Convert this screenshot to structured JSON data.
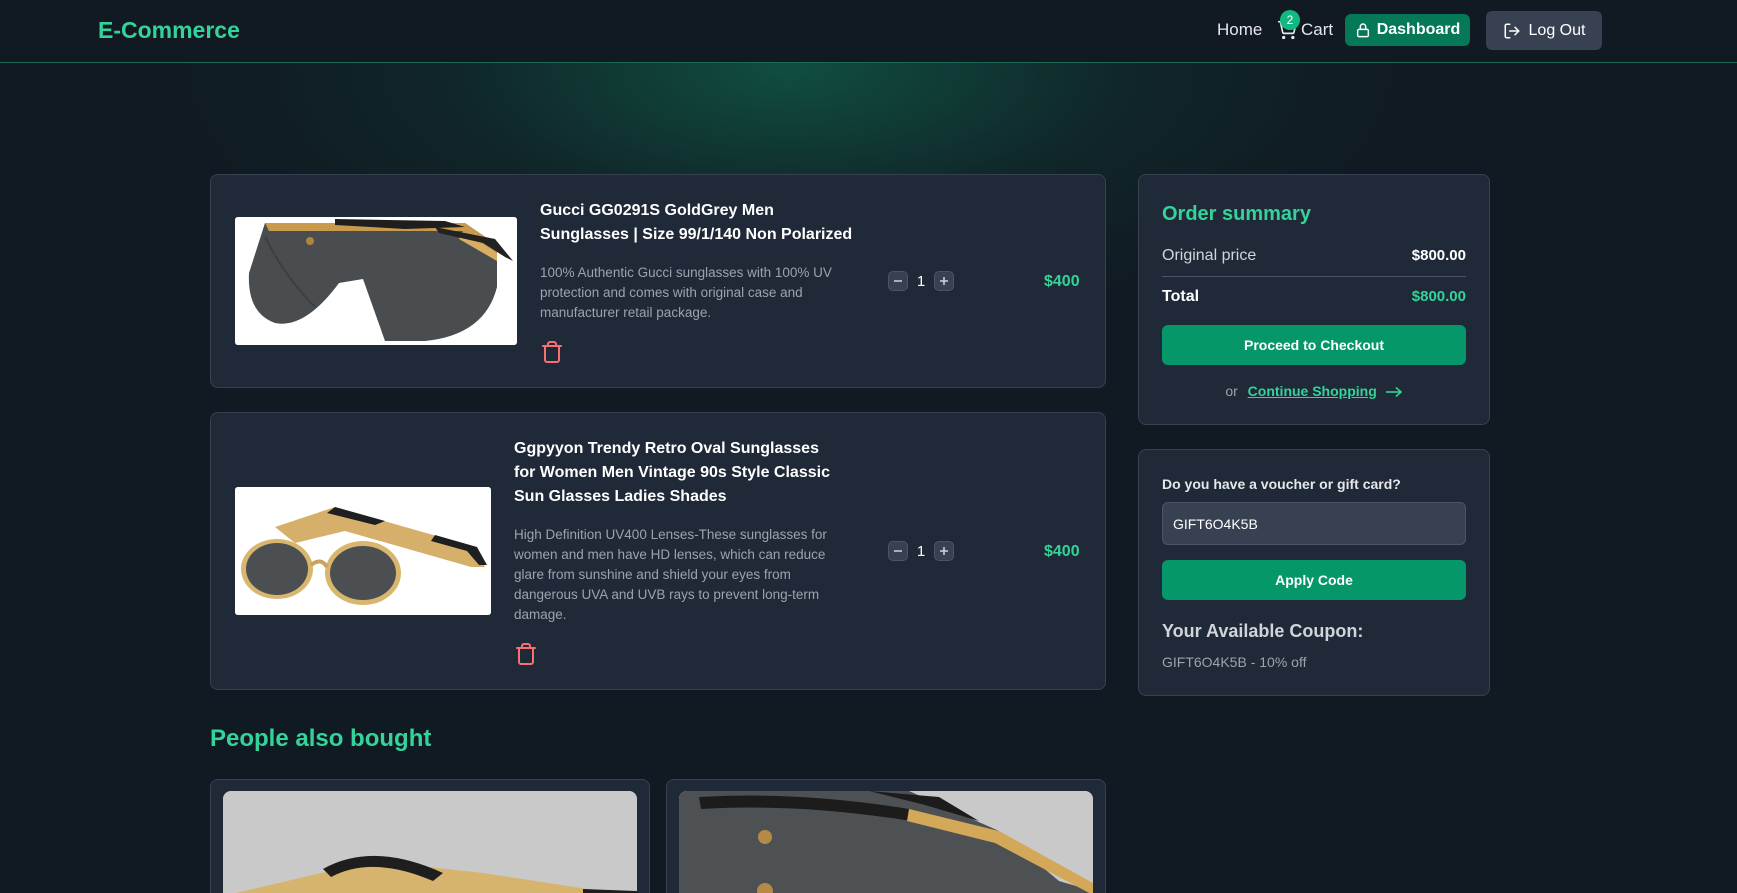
{
  "nav": {
    "brand": "E-Commerce",
    "home": "Home",
    "cart": "Cart",
    "cart_count": "2",
    "dashboard": "Dashboard",
    "logout": "Log Out"
  },
  "cart_items": [
    {
      "title": "Gucci GG0291S GoldGrey Men Sunglasses | Size 99/1/140 Non Polarized",
      "description": "100% Authentic Gucci sunglasses with 100% UV protection and comes with original case and manufacturer retail package.",
      "quantity": "1",
      "price": "$400"
    },
    {
      "title": "Ggpyyon Trendy Retro Oval Sunglasses for Women Men Vintage 90s Style Classic Sun Glasses Ladies Shades",
      "description": "High Definition UV400 Lenses-These sunglasses for women and men have HD lenses, which can reduce glare from sunshine and shield your eyes from dangerous UVA and UVB rays to prevent long-term damage.",
      "quantity": "1",
      "price": "$400"
    }
  ],
  "summary": {
    "title": "Order summary",
    "original_label": "Original price",
    "original_value": "$800.00",
    "total_label": "Total",
    "total_value": "$800.00",
    "checkout": "Proceed to Checkout",
    "or": "or",
    "continue": "Continue Shopping"
  },
  "voucher": {
    "label": "Do you have a voucher or gift card?",
    "value": "GIFT6O4K5B",
    "apply": "Apply Code",
    "available_title": "Your Available Coupon:",
    "available_text": "GIFT6O4K5B - 10% off"
  },
  "also_bought": {
    "title": "People also bought"
  },
  "colors": {
    "accent": "#34d399",
    "button": "#059669",
    "panel": "#1f2937",
    "background": "#101a22",
    "trash": "#f87171"
  }
}
